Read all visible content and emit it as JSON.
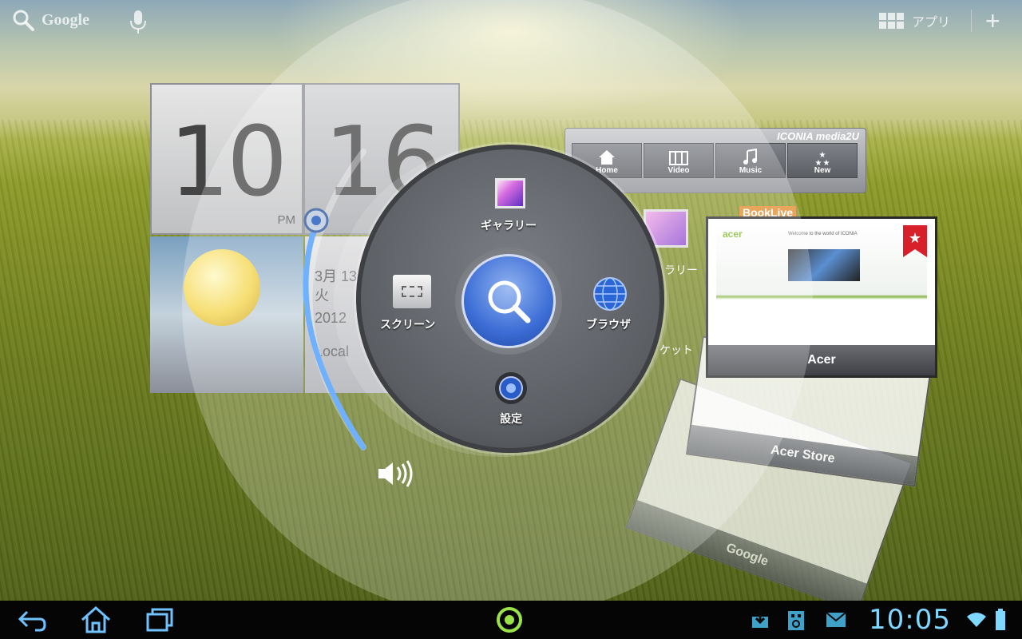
{
  "topbar": {
    "search_label": "Google",
    "apps_label": "アプリ",
    "plus_label": "+"
  },
  "clock_widget": {
    "hour": "10",
    "minute": "16",
    "ampm": "PM",
    "date_line1": "3月 13",
    "date_line2": "火",
    "date_line3": "2012",
    "location": "Local"
  },
  "media_widget": {
    "brand": "ICONIA media2U",
    "buttons": [
      {
        "label": "Home",
        "icon": "house-icon"
      },
      {
        "label": "Video",
        "icon": "film-icon"
      },
      {
        "label": "Music",
        "icon": "music-note-icon"
      },
      {
        "label": "New",
        "icon": "stars-icon"
      }
    ]
  },
  "background_labels": {
    "gallery_partial": "ラリー",
    "market_partial": "ケット",
    "booklive": "BookLive"
  },
  "ring_menu": {
    "top": "ギャラリー",
    "left": "スクリーン",
    "right": "ブラウザ",
    "bottom": "設定"
  },
  "browser_thumbnails": [
    {
      "caption": "Acer",
      "page_text": "Welcome to the world of ICONIA"
    },
    {
      "caption": "Acer Store"
    },
    {
      "caption": "Google"
    }
  ],
  "statusbar": {
    "time": "10:05"
  },
  "colors": {
    "accent_blue": "#3d6ed6",
    "clock_cyan": "#7fd8ff",
    "ring_indicator": "#9be24a"
  }
}
